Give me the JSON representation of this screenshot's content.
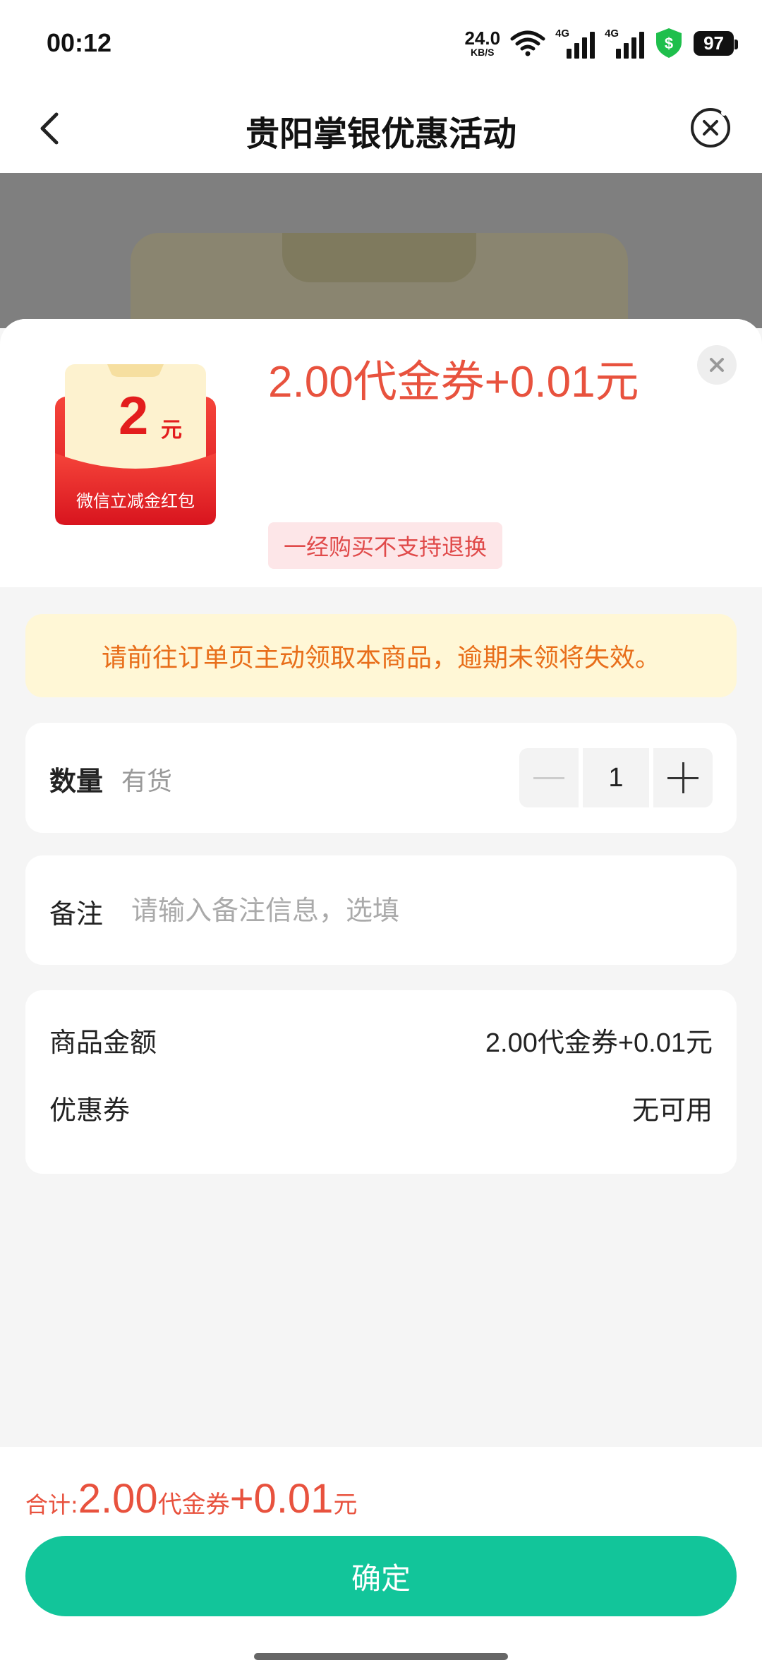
{
  "status_bar": {
    "time": "00:12",
    "net_speed_value": "24.0",
    "net_speed_unit": "KB/S",
    "signal1_label": "4G",
    "signal2_label": "4G",
    "battery": "97"
  },
  "nav": {
    "title": "贵阳掌银优惠活动",
    "back_icon": "chevron-left-icon",
    "close_icon": "close-circle-icon"
  },
  "product": {
    "thumb_amount": "2",
    "thumb_unit": "元",
    "thumb_caption": "微信立减金红包",
    "price_title": "2.00代金券+0.01元",
    "tag": "一经购买不支持退换"
  },
  "notice": "请前往订单页主动领取本商品，逾期未领将失效。",
  "quantity": {
    "label": "数量",
    "stock": "有货",
    "value": "1"
  },
  "remark": {
    "label": "备注",
    "placeholder": "请输入备注信息，选填"
  },
  "summary": {
    "goods_label": "商品金额",
    "goods_value": "2.00代金券+0.01元",
    "coupon_label": "优惠券",
    "coupon_value": "无可用"
  },
  "footer": {
    "total_label": "合计:",
    "total_amount": "2.00",
    "total_unit": "代金券",
    "total_plus": "+0.01",
    "total_yuan": "元",
    "confirm": "确定"
  },
  "colors": {
    "accent_green": "#12c59a",
    "price_red": "#e8523e",
    "notice_orange": "#e86e1a"
  }
}
